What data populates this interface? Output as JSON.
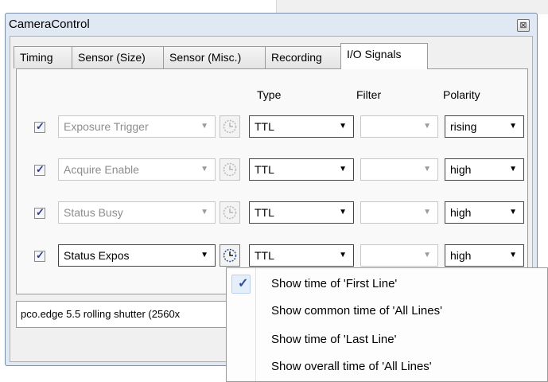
{
  "window": {
    "title": "CameraControl",
    "close_glyph": "⊠"
  },
  "tabs": [
    {
      "label": "Timing",
      "active": false
    },
    {
      "label": "Sensor (Size)",
      "active": false
    },
    {
      "label": "Sensor (Misc.)",
      "active": false
    },
    {
      "label": "Recording",
      "active": false
    },
    {
      "label": "I/O Signals",
      "active": true
    }
  ],
  "columns": {
    "type": "Type",
    "filter": "Filter",
    "polarity": "Polarity"
  },
  "signals": [
    {
      "checked": true,
      "name": "Exposure Trigger",
      "name_enabled": false,
      "clock_enabled": false,
      "type": "TTL",
      "filter": "",
      "polarity": "rising"
    },
    {
      "checked": true,
      "name": "Acquire Enable",
      "name_enabled": false,
      "clock_enabled": false,
      "type": "TTL",
      "filter": "",
      "polarity": "high"
    },
    {
      "checked": true,
      "name": "Status Busy",
      "name_enabled": false,
      "clock_enabled": false,
      "type": "TTL",
      "filter": "",
      "polarity": "high"
    },
    {
      "checked": true,
      "name": "Status Expos",
      "name_enabled": true,
      "clock_enabled": true,
      "type": "TTL",
      "filter": "",
      "polarity": "high"
    }
  ],
  "status_text": "pco.edge 5.5 rolling shutter (2560x",
  "context_menu": {
    "items": [
      {
        "label": "Show time of 'First Line'",
        "checked": true
      },
      {
        "label": "Show common time of 'All Lines'",
        "checked": false
      },
      {
        "label": "Show time of 'Last Line'",
        "checked": false
      },
      {
        "label": "Show overall time of 'All Lines'",
        "checked": false
      }
    ]
  },
  "glyphs": {
    "checkmark": "✓",
    "dropdown_arrow": "▼"
  },
  "colors": {
    "frame": "#dfe8f3",
    "check_accent": "#2a4ea0",
    "disabled_text": "#8d8d8d"
  }
}
